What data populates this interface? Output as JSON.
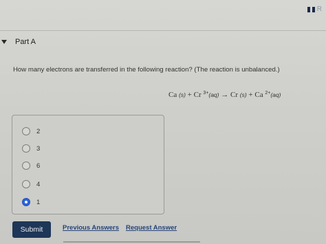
{
  "header": {
    "corner_label": "R"
  },
  "part": {
    "title": "Part A"
  },
  "question": {
    "text": "How many electrons are transferred in the following reaction? (The reaction is unbalanced.)"
  },
  "equation": {
    "ca": "Ca",
    "ca_state": "(s)",
    "plus1": "+",
    "cr": "Cr",
    "cr_charge": "3+",
    "cr_state": "(aq)",
    "arrow": "→",
    "cr2": "Cr",
    "cr2_state": "(s)",
    "plus2": "+",
    "ca2": "Ca",
    "ca2_charge": "2+",
    "ca2_state": "(aq)"
  },
  "choices": [
    {
      "label": "2",
      "selected": false
    },
    {
      "label": "3",
      "selected": false
    },
    {
      "label": "6",
      "selected": false
    },
    {
      "label": "4",
      "selected": false
    },
    {
      "label": "1",
      "selected": true
    }
  ],
  "actions": {
    "submit_label": "Submit",
    "previous_answers_label": "Previous Answers",
    "request_answer_label": "Request Answer"
  },
  "colors": {
    "accent": "#2c63d9",
    "submit_bg": "#1e3657",
    "link": "#25447a"
  }
}
